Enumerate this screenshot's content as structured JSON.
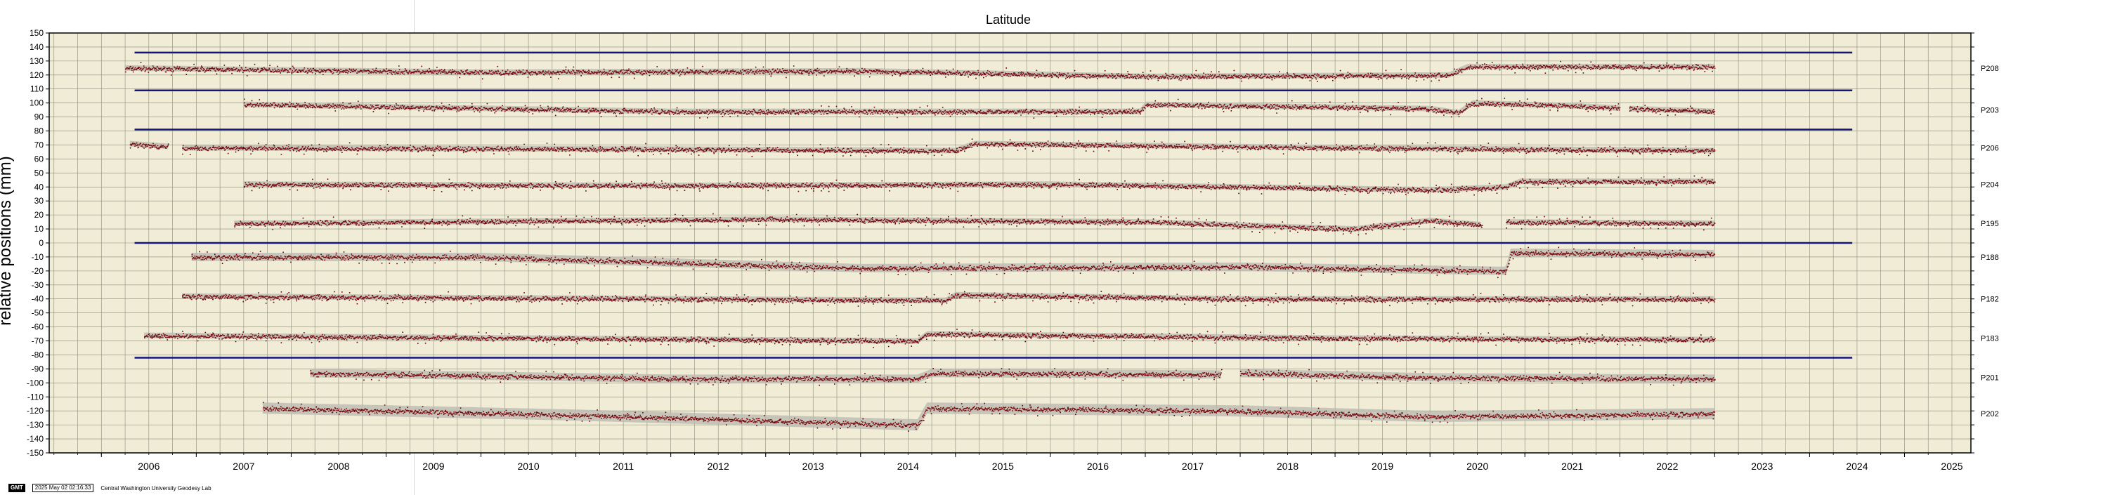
{
  "chart_data": {
    "type": "scatter",
    "title": "Latitude",
    "ylabel": "relative positions (mm)",
    "xlim": [
      2005.45,
      2025.7
    ],
    "ylim": [
      -150,
      150
    ],
    "y_ticks": [
      150,
      140,
      130,
      120,
      110,
      100,
      90,
      80,
      70,
      60,
      50,
      40,
      30,
      20,
      10,
      0,
      -10,
      -20,
      -30,
      -40,
      -50,
      -60,
      -70,
      -80,
      -90,
      -100,
      -110,
      -120,
      -130,
      -140,
      -150
    ],
    "x_ticks": [
      "2006",
      "2007",
      "2008",
      "2009",
      "2010",
      "2011",
      "2012",
      "2013",
      "2014",
      "2015",
      "2016",
      "2017",
      "2018",
      "2019",
      "2020",
      "2021",
      "2022",
      "2023",
      "2024",
      "2025"
    ],
    "grid": true,
    "separator_lines": {
      "x": [
        2006.35,
        2024.45
      ],
      "y": [
        136,
        109,
        81,
        0,
        -82
      ]
    },
    "colors": {
      "points": "#7a0a10",
      "error_band": "#bdbcb2",
      "separator": "#14147a",
      "background": "#f0ecd6",
      "grid": "#7a7a6a"
    },
    "series": [
      {
        "name": "P208",
        "offset": 125,
        "segments": [
          [
            2006.25,
            2023.0
          ]
        ],
        "trend": [
          [
            2006.25,
            125
          ],
          [
            2010,
            122
          ],
          [
            2014,
            123
          ],
          [
            2017,
            119
          ],
          [
            2020.2,
            120
          ],
          [
            2020.4,
            126
          ],
          [
            2023.0,
            126
          ]
        ],
        "band": 2
      },
      {
        "name": "P203",
        "offset": 95,
        "segments": [
          [
            2007.5,
            2022.0
          ],
          [
            2022.1,
            2023.0
          ]
        ],
        "trend": [
          [
            2007.5,
            99
          ],
          [
            2012,
            94
          ],
          [
            2016.95,
            94
          ],
          [
            2017.0,
            99
          ],
          [
            2020,
            96
          ],
          [
            2020.3,
            93
          ],
          [
            2020.45,
            100
          ],
          [
            2021.5,
            98
          ],
          [
            2022.1,
            96
          ],
          [
            2023.0,
            94
          ]
        ],
        "band": 2
      },
      {
        "name": "P206",
        "offset": 68,
        "segments": [
          [
            2006.3,
            2006.7
          ],
          [
            2006.85,
            2023.0
          ]
        ],
        "trend": [
          [
            2006.3,
            71
          ],
          [
            2006.7,
            69
          ],
          [
            2006.85,
            68
          ],
          [
            2012,
            67
          ],
          [
            2015.0,
            66
          ],
          [
            2015.2,
            71
          ],
          [
            2019,
            68
          ],
          [
            2023.0,
            66
          ]
        ],
        "band": 2
      },
      {
        "name": "P204",
        "offset": 42,
        "segments": [
          [
            2007.5,
            2023.0
          ]
        ],
        "trend": [
          [
            2007.5,
            42
          ],
          [
            2012,
            41
          ],
          [
            2016,
            42
          ],
          [
            2020,
            38
          ],
          [
            2020.8,
            40
          ],
          [
            2020.95,
            44
          ],
          [
            2023.0,
            44
          ]
        ],
        "band": 2
      },
      {
        "name": "P195",
        "offset": 14,
        "segments": [
          [
            2007.4,
            2020.55
          ],
          [
            2020.8,
            2023.0
          ]
        ],
        "trend": [
          [
            2007.4,
            14
          ],
          [
            2013,
            17
          ],
          [
            2017,
            15
          ],
          [
            2019.2,
            10
          ],
          [
            2020,
            16
          ],
          [
            2020.55,
            13
          ],
          [
            2020.8,
            15
          ],
          [
            2023.0,
            14
          ]
        ],
        "band": 2
      },
      {
        "name": "P188",
        "offset": -10,
        "segments": [
          [
            2006.95,
            2023.0
          ]
        ],
        "trend": [
          [
            2006.95,
            -10
          ],
          [
            2010,
            -10
          ],
          [
            2014,
            -18
          ],
          [
            2018,
            -17
          ],
          [
            2020.8,
            -20
          ],
          [
            2020.85,
            -7
          ],
          [
            2023.0,
            -8
          ]
        ],
        "band": 3
      },
      {
        "name": "P182",
        "offset": -40,
        "segments": [
          [
            2006.85,
            2023.0
          ]
        ],
        "trend": [
          [
            2006.85,
            -38
          ],
          [
            2014.9,
            -41
          ],
          [
            2015.0,
            -37
          ],
          [
            2018,
            -40
          ],
          [
            2023.0,
            -40
          ]
        ],
        "band": 2
      },
      {
        "name": "P183",
        "offset": -68,
        "segments": [
          [
            2006.45,
            2023.0
          ]
        ],
        "trend": [
          [
            2006.45,
            -66
          ],
          [
            2014.6,
            -70
          ],
          [
            2014.7,
            -65
          ],
          [
            2019,
            -68
          ],
          [
            2023.0,
            -69
          ]
        ],
        "band": 2
      },
      {
        "name": "P201",
        "offset": -96,
        "segments": [
          [
            2008.2,
            2017.8
          ],
          [
            2018.0,
            2023.0
          ]
        ],
        "trend": [
          [
            2008.2,
            -93
          ],
          [
            2012,
            -97
          ],
          [
            2014.6,
            -97
          ],
          [
            2014.75,
            -93
          ],
          [
            2017.8,
            -94
          ],
          [
            2018.0,
            -93
          ],
          [
            2020,
            -96
          ],
          [
            2023.0,
            -97
          ]
        ],
        "band": 3
      },
      {
        "name": "P202",
        "offset": -122,
        "segments": [
          [
            2007.7,
            2023.0
          ]
        ],
        "trend": [
          [
            2007.7,
            -118
          ],
          [
            2011,
            -123
          ],
          [
            2014.6,
            -130
          ],
          [
            2014.7,
            -118
          ],
          [
            2018,
            -120
          ],
          [
            2020,
            -124
          ],
          [
            2023.0,
            -122
          ]
        ],
        "band": 4
      }
    ]
  },
  "footer": {
    "logo": "GMT",
    "timestamp": "2025 May 02 02:16:33",
    "lab": "Central Washington University Geodesy Lab"
  }
}
